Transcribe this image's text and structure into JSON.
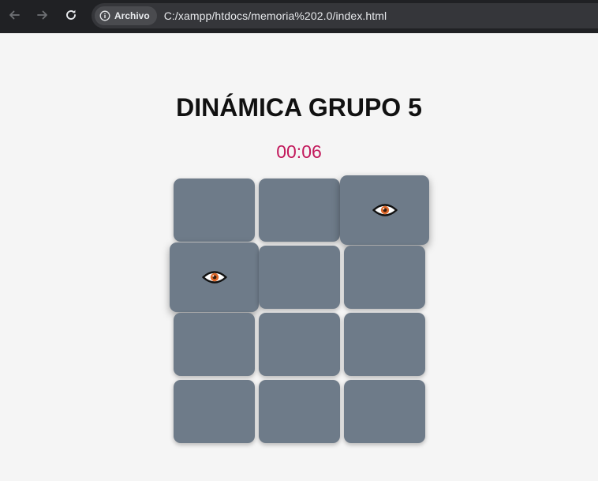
{
  "browser": {
    "site_chip_label": "Archivo",
    "url": "C:/xampp/htdocs/memoria%202.0/index.html",
    "back_icon": "arrow-left-icon",
    "forward_icon": "arrow-right-icon",
    "reload_icon": "reload-icon",
    "info_icon": "info-circle-icon"
  },
  "game": {
    "title": "DINÁMICA GRUPO 5",
    "timer": "00:06",
    "colors": {
      "card_back": "#6e7b89",
      "timer": "#c2185b",
      "eye_iris": "#e06a2c"
    },
    "grid": {
      "rows": 4,
      "cols": 3
    },
    "cards": [
      {
        "row": 1,
        "col": 1,
        "face_up": false
      },
      {
        "row": 1,
        "col": 2,
        "face_up": false
      },
      {
        "row": 1,
        "col": 3,
        "face_up": true,
        "icon": "eye-icon"
      },
      {
        "row": 2,
        "col": 1,
        "face_up": true,
        "icon": "eye-icon"
      },
      {
        "row": 2,
        "col": 2,
        "face_up": false
      },
      {
        "row": 2,
        "col": 3,
        "face_up": false
      },
      {
        "row": 3,
        "col": 1,
        "face_up": false
      },
      {
        "row": 3,
        "col": 2,
        "face_up": false
      },
      {
        "row": 3,
        "col": 3,
        "face_up": false
      },
      {
        "row": 4,
        "col": 1,
        "face_up": false
      },
      {
        "row": 4,
        "col": 2,
        "face_up": false
      },
      {
        "row": 4,
        "col": 3,
        "face_up": false
      }
    ]
  }
}
